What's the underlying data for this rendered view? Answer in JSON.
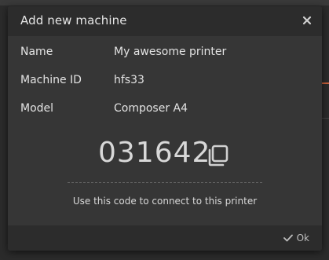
{
  "dialog": {
    "title": "Add new machine",
    "close_icon": "close-icon",
    "fields": {
      "name": {
        "label": "Name",
        "value": "My awesome printer"
      },
      "machine_id": {
        "label": "Machine ID",
        "value": "hfs33"
      },
      "model": {
        "label": "Model",
        "value": "Composer A4"
      }
    },
    "code": "031642",
    "copy_icon": "copy-icon",
    "hint": "Use this code to connect to this printer",
    "ok_label": "Ok",
    "ok_icon": "check-icon"
  },
  "colors": {
    "dialog_bg": "#363636",
    "header_bg": "#2c2c2c",
    "text": "#e3e3e3",
    "accent": "#c8603a"
  }
}
